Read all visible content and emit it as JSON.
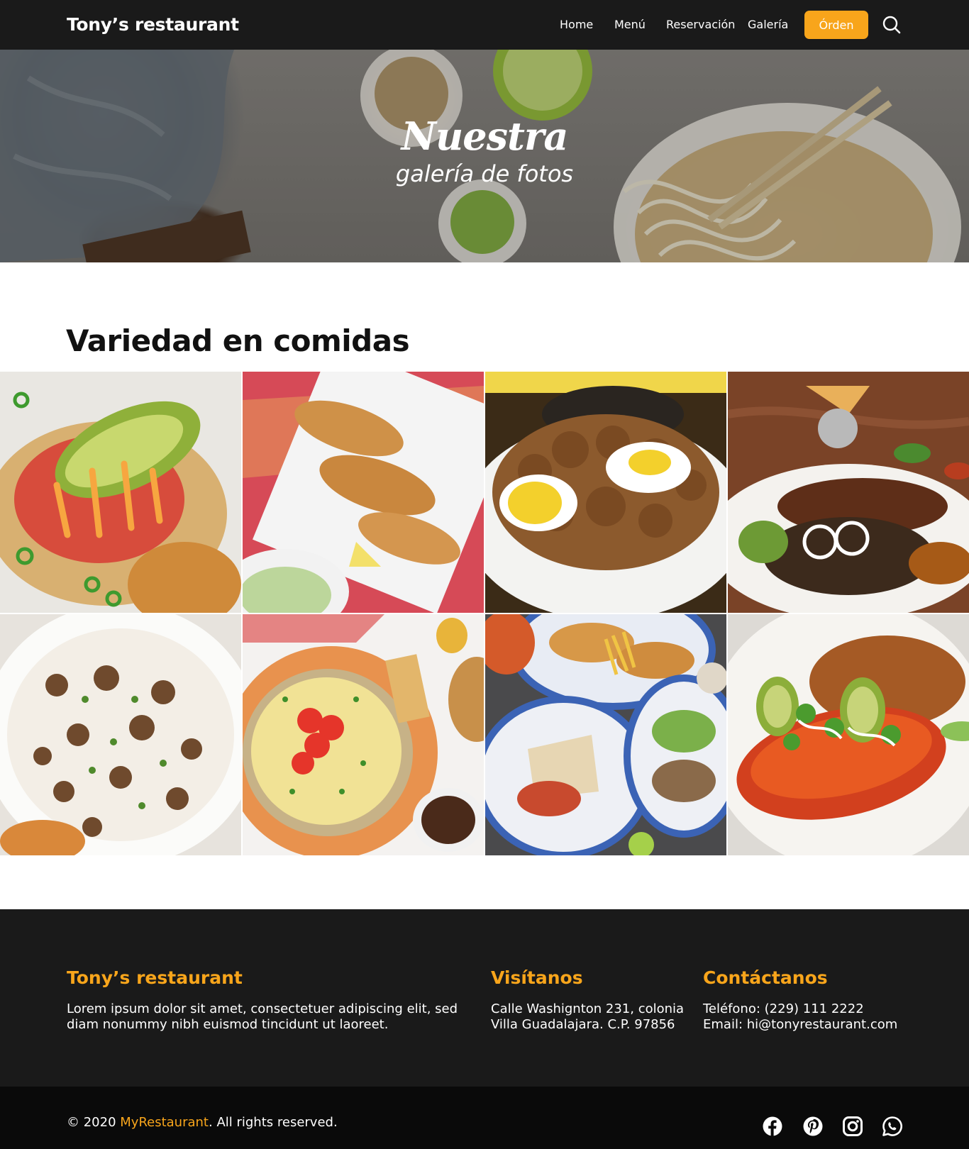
{
  "nav": {
    "brand": "Tony’s restaurant",
    "links": [
      "Home",
      "Menú",
      "Reservación",
      "Galería"
    ],
    "order_label": "Órden",
    "search_icon": "search-icon"
  },
  "hero": {
    "title": "Nuestra",
    "subtitle": "galería de fotos"
  },
  "section": {
    "title": "Variedad en comidas"
  },
  "gallery": {
    "count": 8
  },
  "footer": {
    "col1": {
      "title": "Tony’s restaurant",
      "text": "Lorem ipsum dolor sit amet, consectetuer adipiscing elit, sed\ndiam nonummy nibh euismod tincidunt ut laoreet."
    },
    "col2": {
      "title": "Visítanos",
      "text": "Calle Washignton 231, colonia\nVilla Guadalajara. C.P. 97856"
    },
    "col3": {
      "title": "Contáctanos",
      "text": "Teléfono: (229) 111 2222\nEmail: hi@tonyrestaurant.com"
    }
  },
  "bottom": {
    "copy_prefix": "© 2020 ",
    "copy_brand": "MyRestaurant",
    "copy_suffix": ". All rights reserved.",
    "social_icons": [
      "facebook-icon",
      "pinterest-icon",
      "instagram-icon",
      "whatsapp-icon"
    ]
  },
  "colors": {
    "accent": "#f8a51b",
    "dark": "#1a1a1a",
    "darker": "#0a0a0a"
  }
}
